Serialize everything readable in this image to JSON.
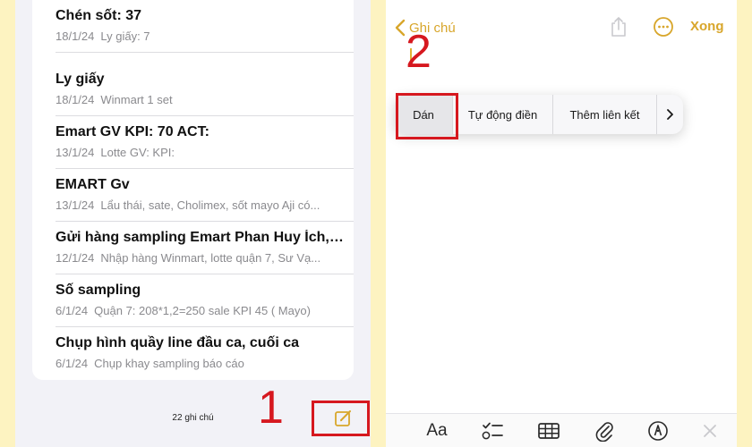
{
  "notes_list": {
    "items": [
      {
        "title": "Chén sốt: 37",
        "date": "18/1/24",
        "preview": "Ly giấy: 7"
      },
      {
        "title": "Ly giấy",
        "date": "18/1/24",
        "preview": "Winmart 1 set"
      },
      {
        "title": "Emart GV KPI: 70 ACT:",
        "date": "13/1/24",
        "preview": "Lotte GV: KPI:"
      },
      {
        "title": "EMART Gv",
        "date": "13/1/24",
        "preview": "Lẩu thái, sate, Cholimex, sốt mayo Aji có..."
      },
      {
        "title": "Gửi hàng sampling Emart Phan Huy Ích, E...",
        "date": "12/1/24",
        "preview": "Nhập hàng Winmart, lotte quận 7, Sư Vạ..."
      },
      {
        "title": "Số sampling",
        "date": "6/1/24",
        "preview": "Quận 7: 208*1,2=250 sale KPI 45 ( Mayo)"
      },
      {
        "title": "Chụp hình quầy line đầu ca, cuối ca",
        "date": "6/1/24",
        "preview": "Chụp khay sampling báo cáo"
      }
    ],
    "count_label": "22 ghi chú",
    "compose_icon": "compose-icon"
  },
  "annotations": {
    "step1": "1",
    "step2": "2",
    "color": "#d6181f"
  },
  "editor": {
    "back_label": "Ghi chú",
    "done_label": "Xong",
    "share_icon": "share-icon",
    "more_icon": "ellipsis-circle-icon"
  },
  "context_menu": {
    "paste": "Dán",
    "autofill": "Tự động điền",
    "add_link": "Thêm liên kết",
    "more_icon": "chevron-right-icon"
  },
  "toolbar": {
    "format_label": "Aa",
    "checklist_icon": "checklist-icon",
    "table_icon": "table-icon",
    "attach_icon": "paperclip-icon",
    "markup_icon": "markup-pen-icon",
    "close_icon": "close-icon"
  },
  "colors": {
    "accent": "#d8a62b",
    "background": "#fdf3c1",
    "annotation": "#d6181f"
  }
}
